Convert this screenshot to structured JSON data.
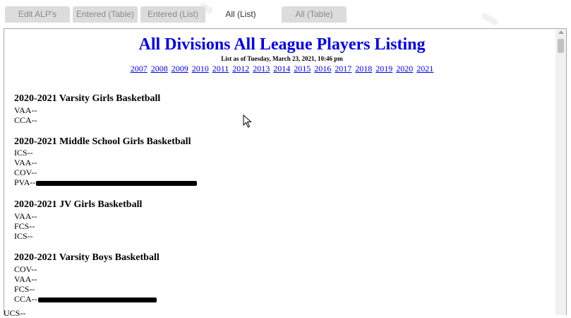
{
  "tabs": [
    {
      "label": "Edit ALP's",
      "active": false
    },
    {
      "label": "Entered (Table)",
      "active": false
    },
    {
      "label": "Entered (List)",
      "active": false
    },
    {
      "label": "All (List)",
      "active": true
    },
    {
      "label": "All (Table)",
      "active": false
    }
  ],
  "page": {
    "title": "All Divisions All League Players Listing",
    "as_of": "List as of Tuesday, March 23, 2021, 10:46 pm",
    "years": [
      "2007",
      "2008",
      "2009",
      "2010",
      "2011",
      "2012",
      "2013",
      "2014",
      "2015",
      "2016",
      "2017",
      "2018",
      "2019",
      "2020",
      "2021"
    ]
  },
  "sections": [
    {
      "heading": "2020-2021 Varsity Girls Basketball",
      "rows": [
        "VAA--",
        "CCA--"
      ]
    },
    {
      "heading": "2020-2021 Middle School Girls Basketball",
      "rows": [
        "ICS--",
        "VAA--",
        "COV--",
        "PVA--"
      ]
    },
    {
      "heading": "2020-2021 JV Girls Basketball",
      "rows": [
        "VAA--",
        "FCS--",
        "ICS--"
      ]
    },
    {
      "heading": "2020-2021 Varsity Boys Basketball",
      "rows": [
        "COV--",
        "VAA--",
        "FCS--",
        "CCA--"
      ]
    }
  ],
  "partial_row": "UCS--",
  "colors": {
    "link": "#0000ee",
    "tab_bg": "#dcdcdc",
    "redaction": "#000000"
  }
}
